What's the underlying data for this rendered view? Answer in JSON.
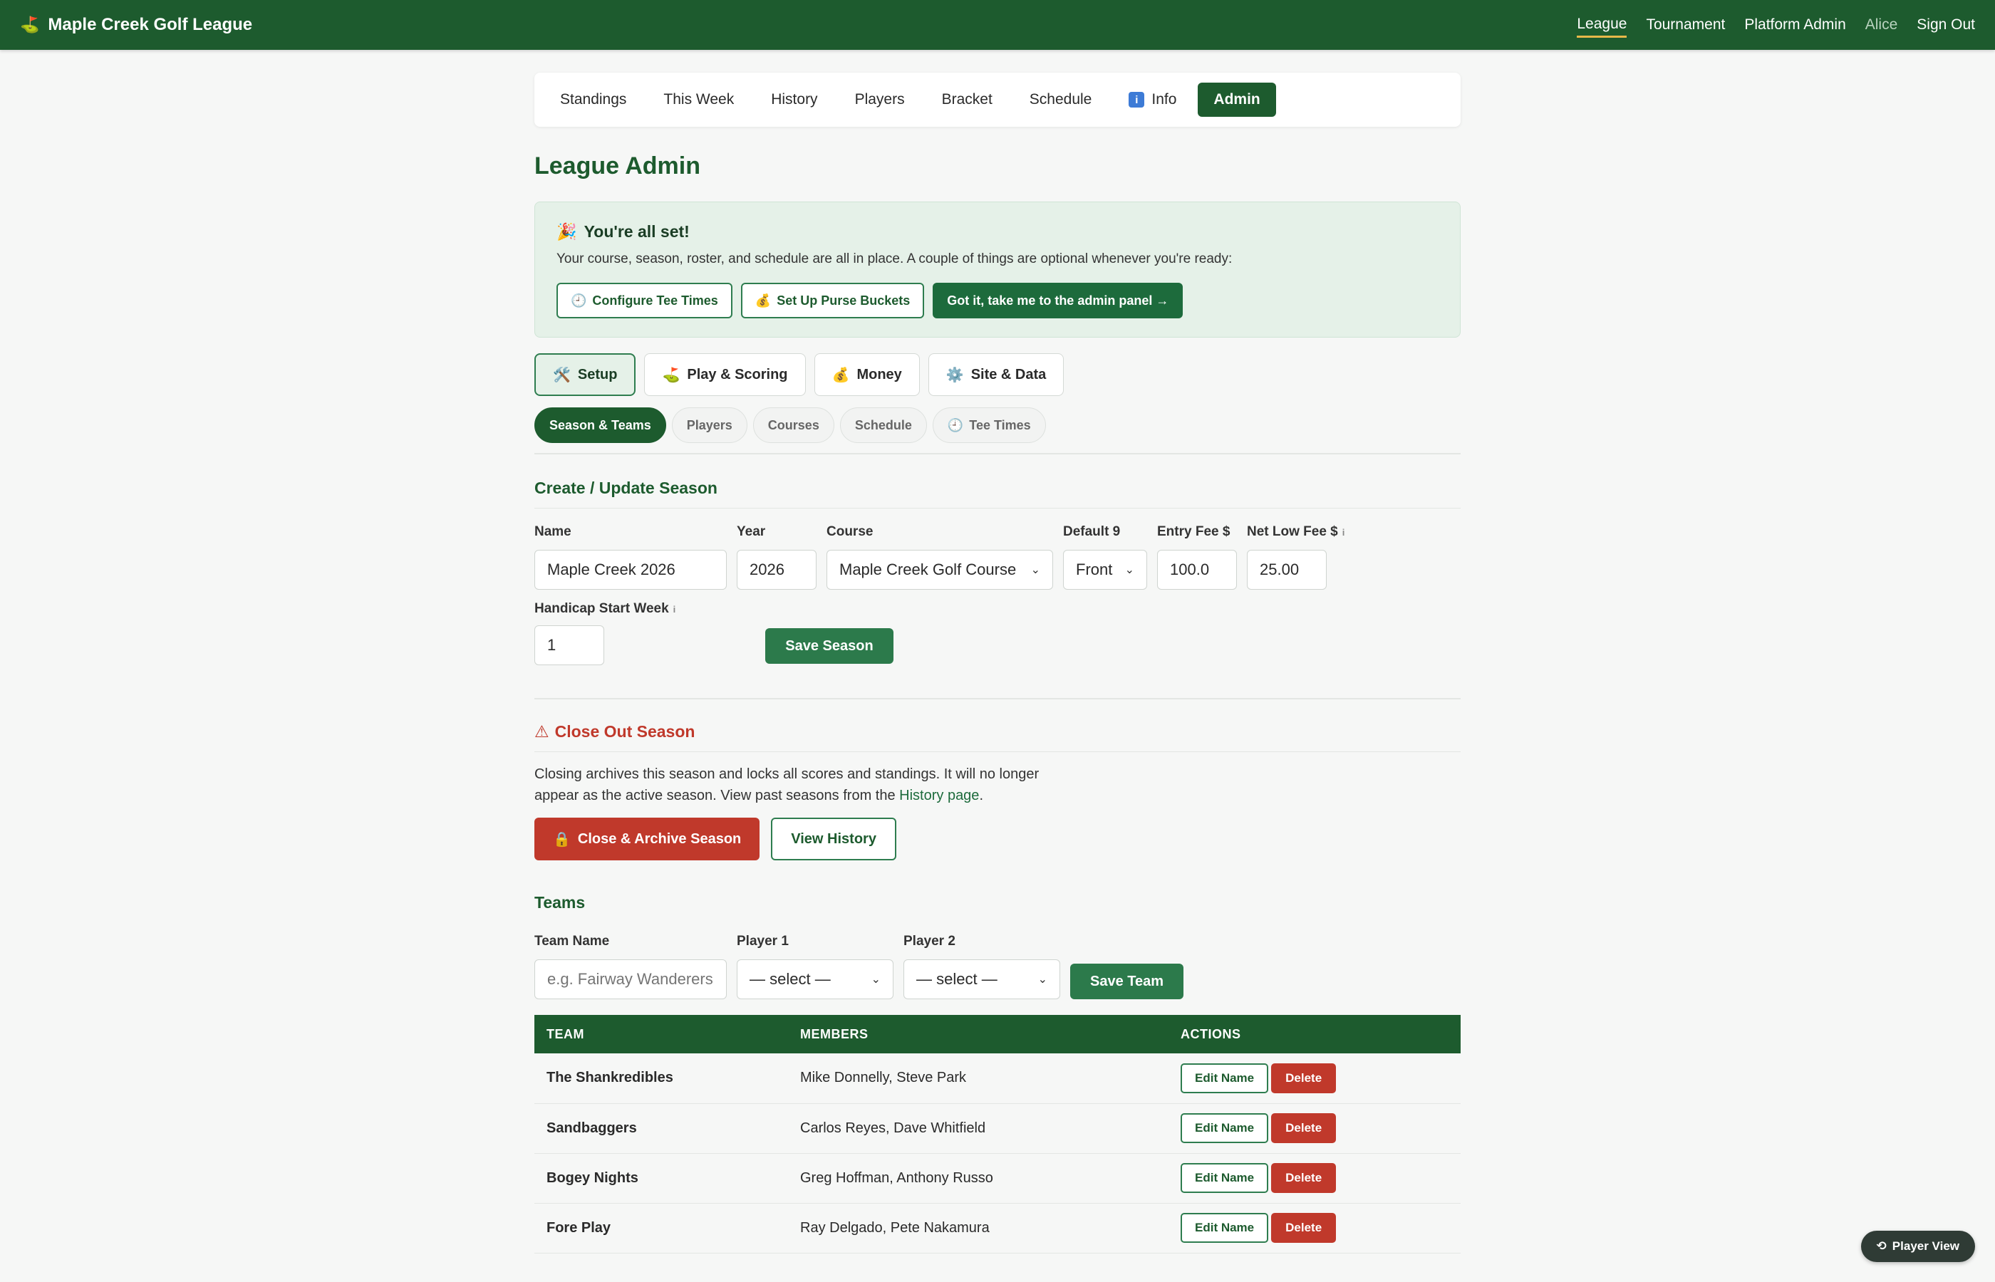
{
  "brand": {
    "icon": "golf-flag-icon",
    "title": "Maple Creek Golf League"
  },
  "topnav": {
    "league": "League",
    "tournament": "Tournament",
    "platform_admin": "Platform Admin",
    "user": "Alice",
    "sign_out": "Sign Out"
  },
  "tabs": [
    "Standings",
    "This Week",
    "History",
    "Players",
    "Bracket",
    "Schedule",
    "Info",
    "Admin"
  ],
  "page_title": "League Admin",
  "banner": {
    "title": "You're all set!",
    "text": "Your course, season, roster, and schedule are all in place. A couple of things are optional whenever you're ready:",
    "tee_times": "Configure Tee Times",
    "purse": "Set Up Purse Buckets",
    "got_it": "Got it, take me to the admin panel →"
  },
  "cat_tabs": [
    "Setup",
    "Play & Scoring",
    "Money",
    "Site & Data"
  ],
  "sub_tabs": [
    "Season & Teams",
    "Players",
    "Courses",
    "Schedule",
    "Tee Times"
  ],
  "season": {
    "title": "Create / Update Season",
    "name_label": "Name",
    "name_value": "Maple Creek 2026",
    "year_label": "Year",
    "year_value": "2026",
    "course_label": "Course",
    "course_value": "Maple Creek Golf Course",
    "default9_label": "Default 9",
    "default9_value": "Front",
    "entry_label": "Entry Fee $",
    "entry_value": "100.0",
    "netlow_label": "Net Low Fee $",
    "netlow_value": "25.00",
    "hcp_label": "Handicap Start Week",
    "hcp_value": "1",
    "save": "Save Season",
    "hint": "i"
  },
  "closeout": {
    "title": "Close Out Season",
    "text": "Closing archives this season and locks all scores and standings. It will no longer appear as the active season. View past seasons from the",
    "link": "History page",
    "period": ".",
    "close_btn": "Close & Archive Season",
    "view_btn": "View History"
  },
  "teams": {
    "title": "Teams",
    "team_name_label": "Team Name",
    "team_name_placeholder": "e.g. Fairway Wanderers",
    "p1_label": "Player 1",
    "p1_value": "— select —",
    "p2_label": "Player 2",
    "p2_value": "— select —",
    "save": "Save Team",
    "columns": [
      "TEAM",
      "MEMBERS",
      "ACTIONS"
    ],
    "edit": "Edit Name",
    "delete": "Delete",
    "rows": [
      {
        "team": "The Shankredibles",
        "members": "Mike Donnelly, Steve Park"
      },
      {
        "team": "Sandbaggers",
        "members": "Carlos Reyes, Dave Whitfield"
      },
      {
        "team": "Bogey Nights",
        "members": "Greg Hoffman, Anthony Russo"
      },
      {
        "team": "Fore Play",
        "members": "Ray Delgado, Pete Nakamura"
      }
    ]
  },
  "player_view": "Player View",
  "colors": {
    "primary": "#1d5b2e",
    "accent_underline": "#e8b84a",
    "danger": "#c0392b",
    "banner_bg": "#e5f1e8"
  }
}
